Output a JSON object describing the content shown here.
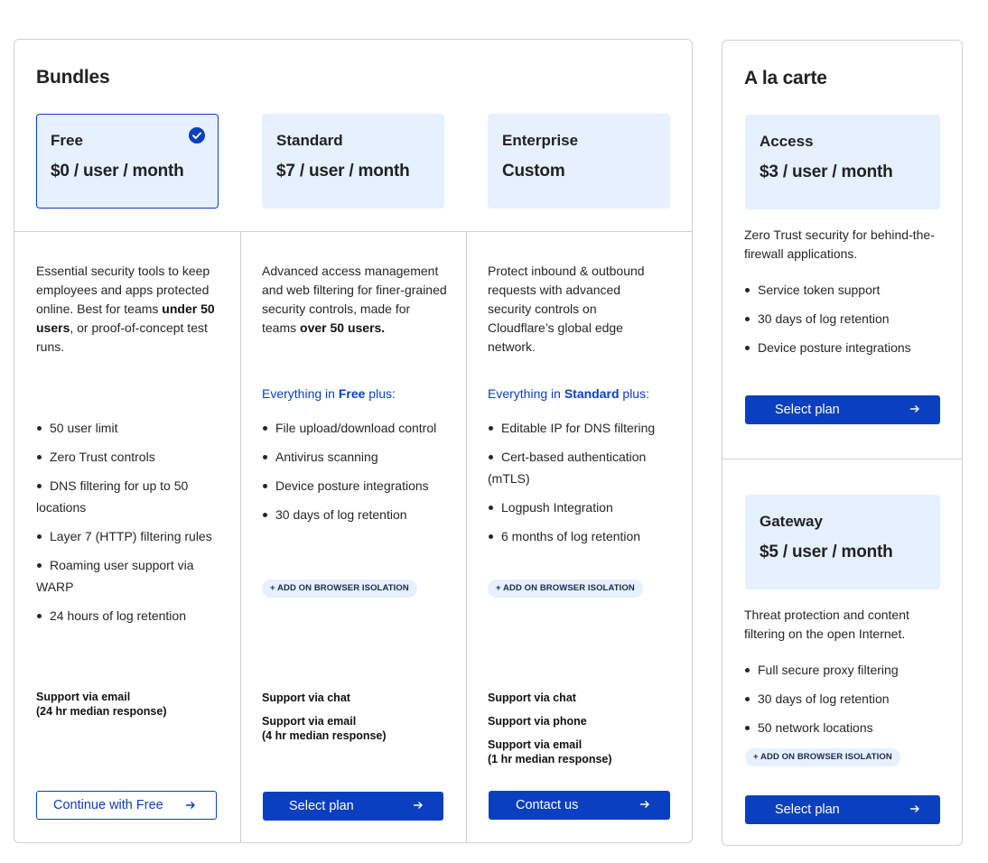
{
  "bundles": {
    "title": "Bundles",
    "tiers": [
      {
        "name": "Free",
        "price": "$0 / user / month",
        "description": {
          "pre": "Essential security tools to keep employees and apps protected online. Best for teams ",
          "bold": "under 50 users",
          "post": ", or proof-of-concept test runs."
        },
        "features": [
          "50 user limit",
          "Zero Trust controls",
          "DNS filtering for up to 50 locations",
          "Layer 7 (HTTP) filtering rules",
          "Roaming user support via WARP",
          "24 hours of log retention"
        ],
        "support": [
          "Support via email\n(24 hr median response)"
        ],
        "button": "Continue with Free"
      },
      {
        "name": "Standard",
        "price": "$7 / user / month",
        "description": {
          "pre": "Advanced access management and web filtering for finer-grained security controls, made for teams ",
          "bold": "over 50 users.",
          "post": ""
        },
        "plus": {
          "pre": "Everything in ",
          "bold": "Free",
          "post": " plus:"
        },
        "features": [
          "File upload/download control",
          "Antivirus scanning",
          "Device posture integrations",
          "30 days of log retention"
        ],
        "addon": "+ ADD ON BROWSER ISOLATION",
        "support": [
          "Support via chat",
          "Support via email\n(4 hr median response)"
        ],
        "button": "Select plan"
      },
      {
        "name": "Enterprise",
        "price": "Custom",
        "description": {
          "pre": "Protect inbound & outbound requests with advanced security controls on Cloudflare’s global edge network.",
          "bold": "",
          "post": ""
        },
        "plus": {
          "pre": "Everything in ",
          "bold": "Standard",
          "post": " plus:"
        },
        "features": [
          "Editable IP for DNS filtering",
          "Cert-based authentication (mTLS)",
          "Logpush Integration",
          "6 months of log retention"
        ],
        "addon": "+ ADD ON BROWSER ISOLATION",
        "support": [
          "Support via chat",
          "Support via phone",
          "Support via email\n(1 hr median response)"
        ],
        "button": "Contact us"
      }
    ]
  },
  "carte": {
    "title": "A la carte",
    "items": [
      {
        "name": "Access",
        "price": "$3 / user / month",
        "description": "Zero Trust security for behind-the-firewall applications.",
        "features": [
          "Service token support",
          "30 days of log retention",
          "Device posture integrations"
        ],
        "button": "Select plan"
      },
      {
        "name": "Gateway",
        "price": "$5 / user / month",
        "description": "Threat protection and content filtering on the open Internet.",
        "features": [
          "Full secure proxy filtering",
          "30 days of log retention",
          "50 network locations"
        ],
        "addon": "+ ADD ON BROWSER ISOLATION",
        "button": "Select plan"
      }
    ]
  },
  "colors": {
    "accent": "#0a3fbf",
    "card_bg": "#e6f0ff",
    "border": "#d2d2d2"
  }
}
